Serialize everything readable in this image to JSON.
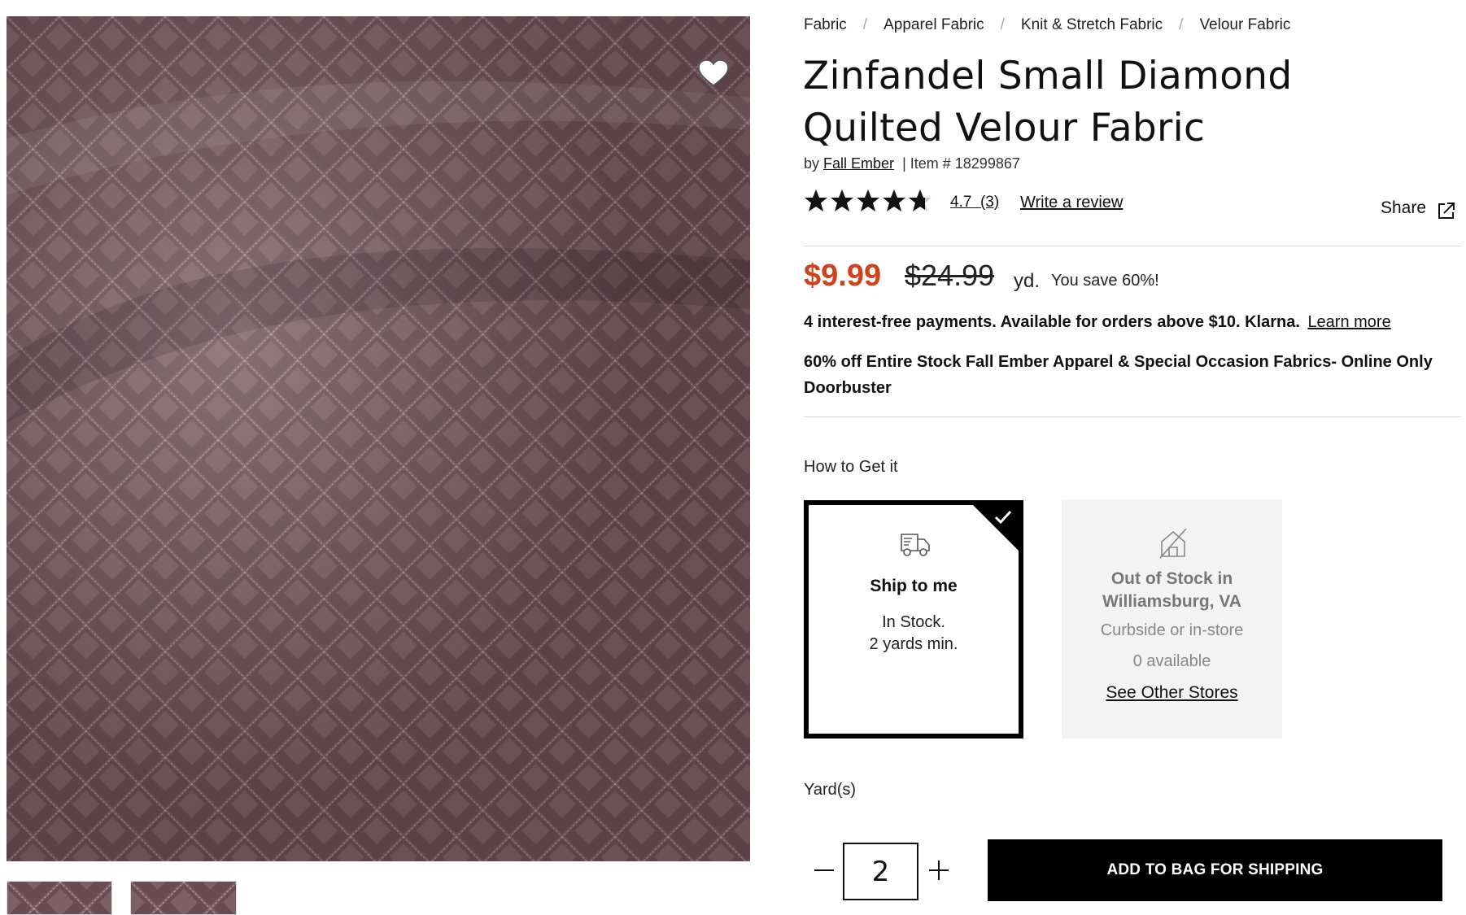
{
  "breadcrumb": [
    "Fabric",
    "Apparel Fabric",
    "Knit & Stretch Fabric",
    "Velour Fabric"
  ],
  "product": {
    "title": "Zinfandel Small Diamond Quilted Velour Fabric",
    "by_prefix": "by",
    "brand": "Fall Ember",
    "item_label": "| Item # 18299867",
    "rating_value": 4.7,
    "rating_text": "4.7",
    "review_count": "(3)",
    "write_review": "Write a review",
    "share": "Share"
  },
  "price": {
    "sale": "$9.99",
    "original": "$24.99",
    "unit": "yd.",
    "savings": "You save 60%!"
  },
  "klarna": {
    "text": "4 interest-free payments. Available for orders above $10. Klarna.",
    "link": "Learn more"
  },
  "promo": "60% off Entire Stock Fall Ember Apparel & Special Occasion Fabrics- Online Only Doorbuster",
  "fulfillment": {
    "label": "How to Get it",
    "ship": {
      "title": "Ship to me",
      "line1": "In Stock.",
      "line2": "2 yards min.",
      "icon": "truck-icon",
      "selected": true
    },
    "store": {
      "title": "Out of Stock in Williamsburg, VA",
      "line1": "Curbside or in-store",
      "line2": "0 available",
      "link": "See Other Stores",
      "icon": "store-unavailable-icon"
    }
  },
  "quantity": {
    "label": "Yard(s)",
    "value": "2"
  },
  "cta": "ADD TO BAG FOR SHIPPING",
  "colors": {
    "sale_price": "#d0421b",
    "fabric": "#7a5a62",
    "cta_bg": "#000000"
  }
}
